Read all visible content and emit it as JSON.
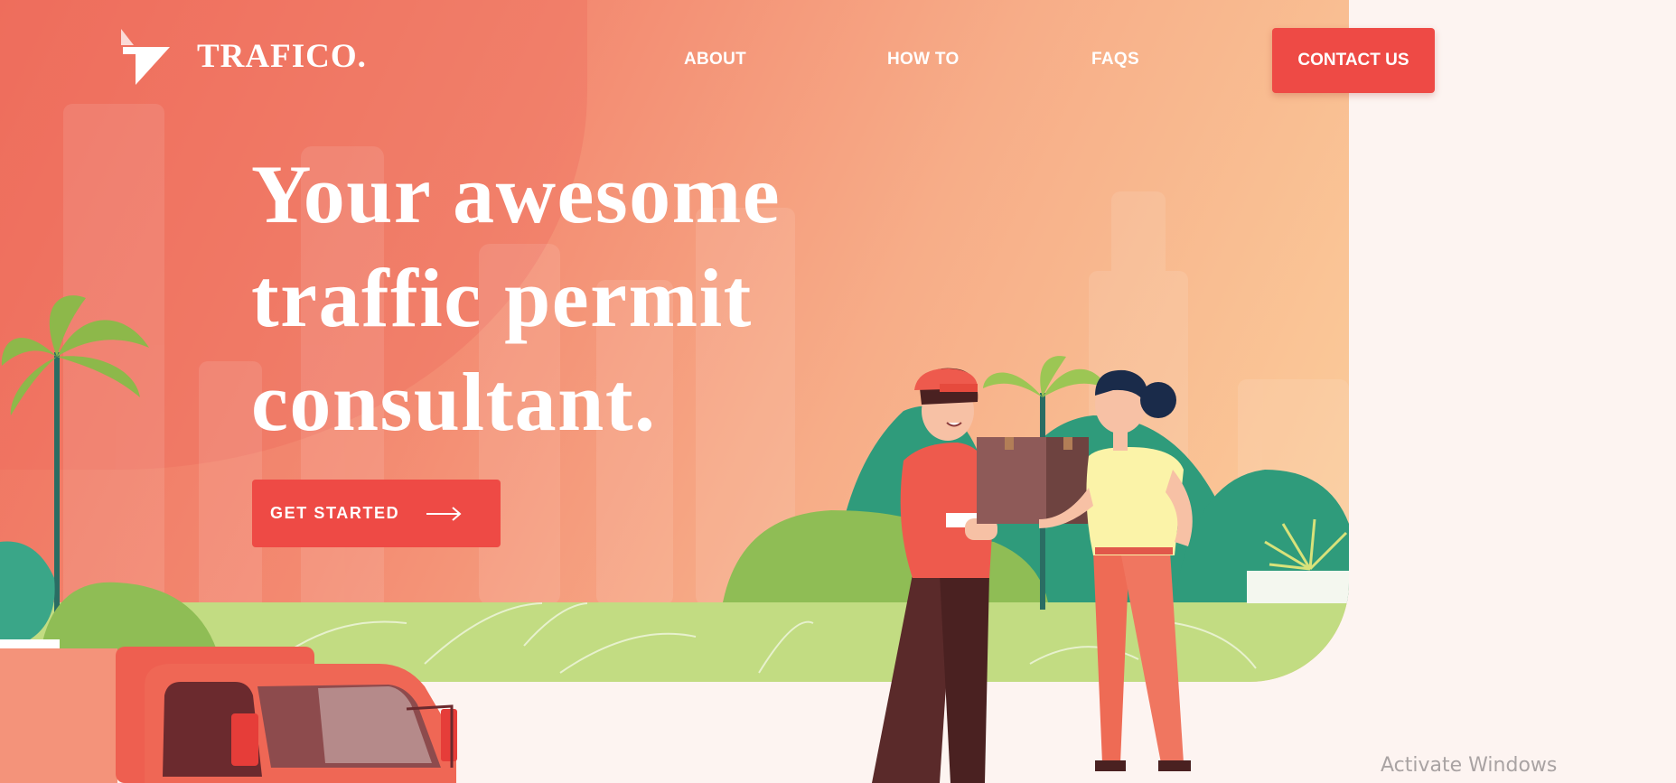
{
  "brand": {
    "name": "TRAFICO.",
    "logo_icon": "trafico-logo-icon"
  },
  "nav": {
    "links": [
      {
        "label": "ABOUT"
      },
      {
        "label": "HOW TO"
      },
      {
        "label": "FAQS"
      }
    ],
    "contact_label": "CONTACT US"
  },
  "hero": {
    "headline_lines": [
      "Your awesome",
      "traffic permit",
      "consultant."
    ],
    "cta_label": "GET STARTED",
    "cta_icon": "arrow-right-icon"
  },
  "system": {
    "watermark": "Activate Windows"
  },
  "colors": {
    "accent": "#ee4a45",
    "hero_start": "#ef6f5d",
    "hero_end": "#fbcf9c",
    "ground": "#c2dc82",
    "page_bg": "#fdf4f1"
  }
}
